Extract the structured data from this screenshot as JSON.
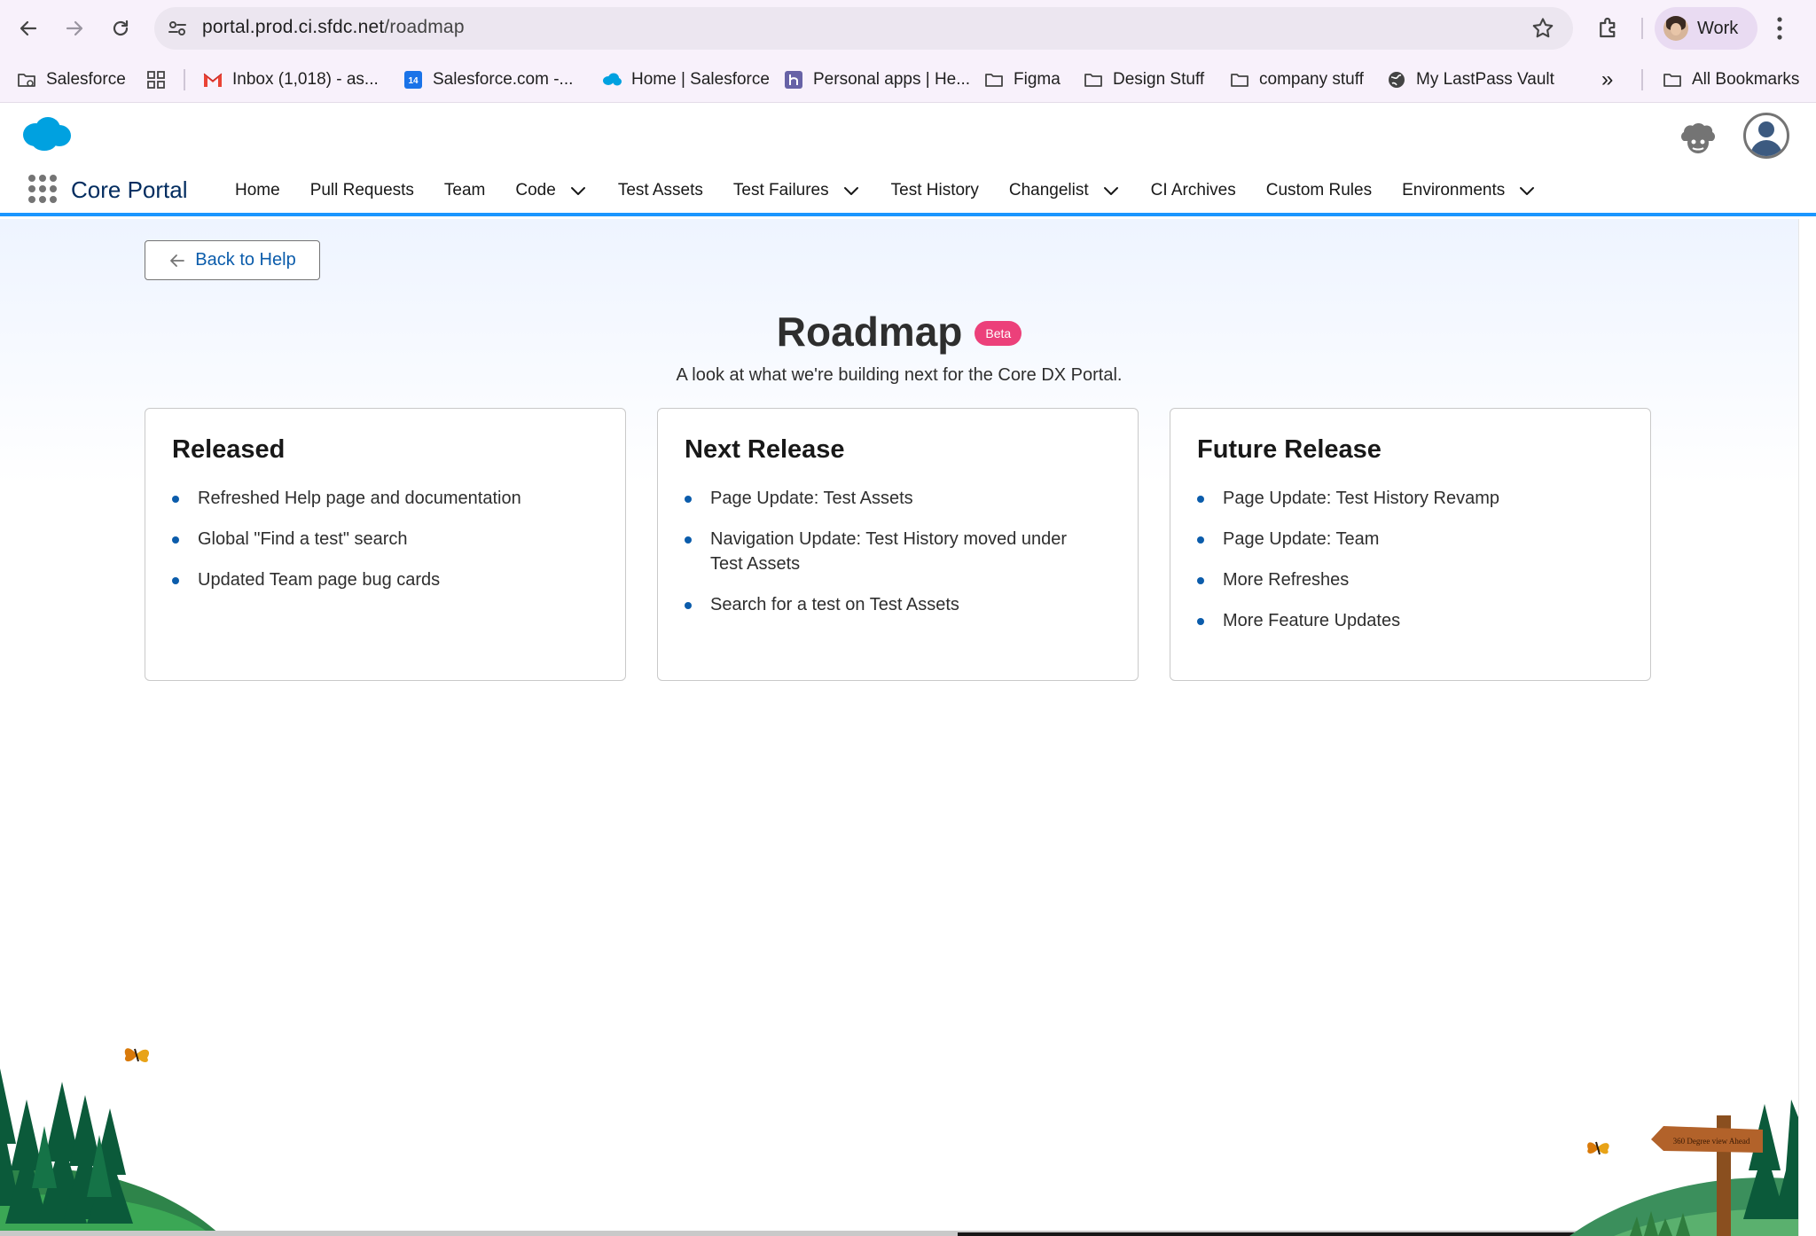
{
  "browser": {
    "url_host": "portal.prod.ci.sfdc.net",
    "url_path": "/roadmap",
    "profile_label": "Work",
    "bookmarks": [
      {
        "label": "Salesforce",
        "icon": "folder-gear-icon"
      },
      {
        "label": "",
        "icon": "apps-grid-icon"
      },
      {
        "label": "Inbox (1,018) - as...",
        "icon": "gmail-icon"
      },
      {
        "label": "Salesforce.com -...",
        "icon": "calendar-icon"
      },
      {
        "label": "Home | Salesforce",
        "icon": "salesforce-cloud-icon"
      },
      {
        "label": "Personal apps | He...",
        "icon": "heroku-icon"
      },
      {
        "label": "Figma",
        "icon": "folder-icon"
      },
      {
        "label": "Design Stuff",
        "icon": "folder-icon"
      },
      {
        "label": "company stuff",
        "icon": "folder-icon"
      },
      {
        "label": "My LastPass Vault",
        "icon": "globe-icon"
      }
    ],
    "more_label": "»",
    "all_bookmarks_label": "All Bookmarks"
  },
  "app": {
    "name": "Core Portal",
    "nav": [
      {
        "label": "Home",
        "dropdown": false
      },
      {
        "label": "Pull Requests",
        "dropdown": false
      },
      {
        "label": "Team",
        "dropdown": false
      },
      {
        "label": "Code",
        "dropdown": true
      },
      {
        "label": "Test Assets",
        "dropdown": false
      },
      {
        "label": "Test Failures",
        "dropdown": true
      },
      {
        "label": "Test History",
        "dropdown": false
      },
      {
        "label": "Changelist",
        "dropdown": true
      },
      {
        "label": "CI Archives",
        "dropdown": false
      },
      {
        "label": "Custom Rules",
        "dropdown": false
      },
      {
        "label": "Environments",
        "dropdown": true
      }
    ]
  },
  "page": {
    "back_label": "Back to Help",
    "title": "Roadmap",
    "badge": "Beta",
    "subtitle": "A look at what we're building next for the Core DX Portal.",
    "columns": [
      {
        "heading": "Released",
        "items": [
          "Refreshed Help page and documentation",
          "Global \"Find a test\" search",
          "Updated Team page bug cards"
        ]
      },
      {
        "heading": "Next Release",
        "items": [
          "Page Update: Test Assets",
          "Navigation Update: Test History moved under Test Assets",
          "Search for a test on Test Assets"
        ]
      },
      {
        "heading": "Future Release",
        "items": [
          "Page Update: Test History Revamp",
          "Page Update: Team",
          "More Refreshes",
          "More Feature Updates"
        ]
      }
    ],
    "signpost_text": "360 Degree view Ahead"
  },
  "colors": {
    "brand_blue": "#1b96ff",
    "link_blue": "#0b5cab",
    "badge_pink": "#ec407a",
    "app_name_navy": "#032d60"
  }
}
